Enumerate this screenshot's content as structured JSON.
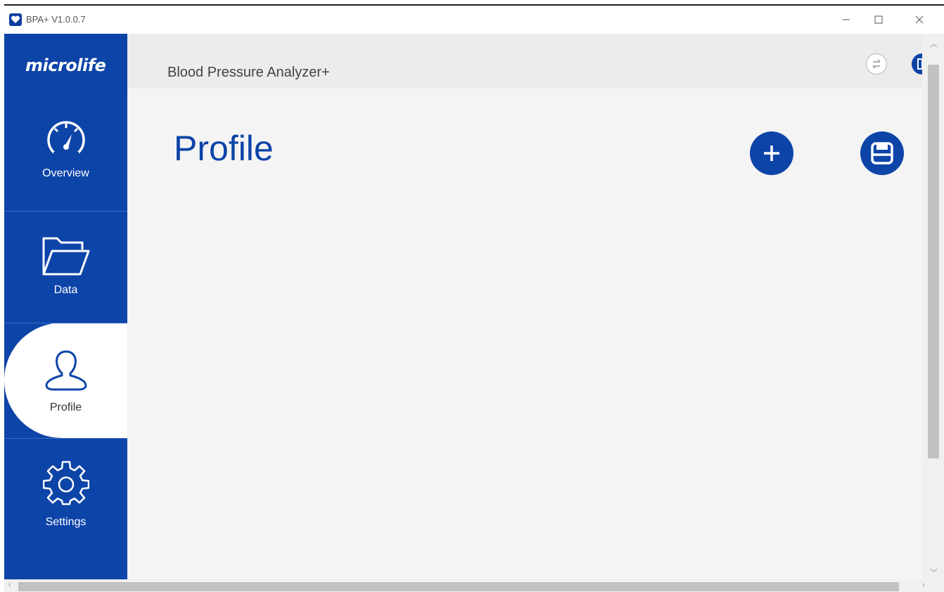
{
  "window": {
    "title": "BPA+ V1.0.0.7"
  },
  "sidebar": {
    "logo": "microlife",
    "items": [
      {
        "label": "Overview",
        "icon": "gauge-icon"
      },
      {
        "label": "Data",
        "icon": "folder-icon"
      },
      {
        "label": "Profile",
        "icon": "user-icon",
        "active": true
      },
      {
        "label": "Settings",
        "icon": "gear-icon"
      }
    ]
  },
  "header": {
    "app_name": "Blood Pressure Analyzer+",
    "icons": [
      "sync-icon",
      "language-icon"
    ]
  },
  "main": {
    "page_title": "Profile",
    "actions": [
      {
        "name": "add",
        "icon": "plus-icon"
      },
      {
        "name": "save",
        "icon": "save-icon"
      }
    ]
  },
  "colors": {
    "brand_blue": "#0d44a8",
    "content_bg": "#f4f4f4",
    "header_bg": "#ececec"
  }
}
